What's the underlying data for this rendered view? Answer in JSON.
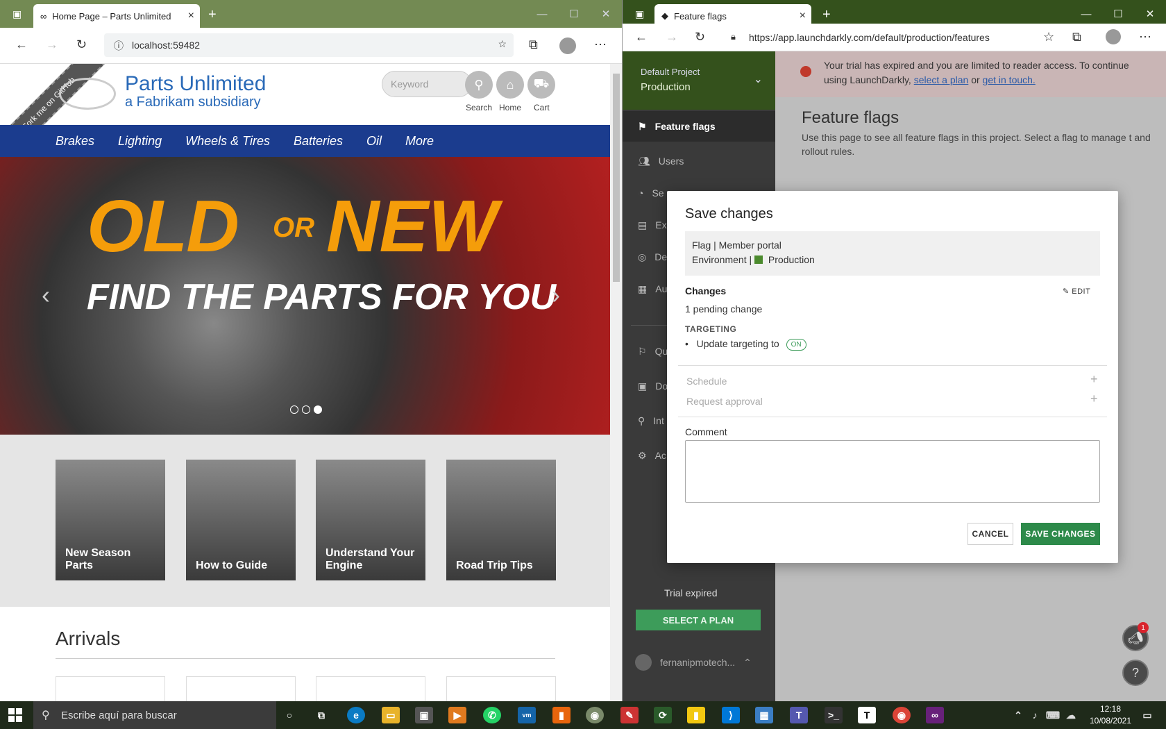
{
  "left_browser": {
    "tab_title": "Home Page – Parts Unlimited",
    "url": "localhost:59482",
    "site": {
      "logo_title": "Parts Unlimited",
      "logo_subtitle": "a Fabrikam subsidiary",
      "ribbon": "Fork me on GitHub",
      "search_placeholder": "Keyword",
      "search_label": "Search",
      "home_label": "Home",
      "cart_label": "Cart",
      "nav": [
        "Brakes",
        "Lighting",
        "Wheels & Tires",
        "Batteries",
        "Oil",
        "More"
      ],
      "hero": {
        "old": "OLD",
        "or": "OR",
        "new": "NEW",
        "subtitle": "FIND THE PARTS FOR YOU",
        "active_slide": 3,
        "slide_count": 3
      },
      "tiles": [
        "New Season Parts",
        "How to Guide",
        "Understand Your Engine",
        "Road Trip Tips"
      ],
      "arrivals_heading": "Arrivals"
    }
  },
  "right_browser": {
    "tab_title": "Feature flags",
    "url": "https://app.launchdarkly.com/default/production/features",
    "sidebar": {
      "project": "Default Project",
      "environment": "Production",
      "items": [
        {
          "label": "Feature flags",
          "icon": "flag-icon",
          "active": true
        },
        {
          "label": "Users",
          "icon": "users-icon"
        },
        {
          "label": "Se",
          "icon": "segments-icon"
        },
        {
          "label": "Ex",
          "icon": "experiments-icon"
        },
        {
          "label": "De",
          "icon": "debugger-icon"
        },
        {
          "label": "Au",
          "icon": "audit-icon"
        },
        {
          "label": "Qu",
          "icon": "quickstart-icon"
        },
        {
          "label": "Do",
          "icon": "docs-icon"
        },
        {
          "label": "Int",
          "icon": "integrations-icon"
        },
        {
          "label": "Ac",
          "icon": "account-icon"
        }
      ],
      "trial_expired": "Trial expired",
      "select_plan": "SELECT A PLAN",
      "user": "fernanipmotech..."
    },
    "banner": {
      "text": "Your trial has expired and you are limited to reader access. To continue using LaunchDarkly,",
      "link1": "select a plan",
      "or": "or",
      "link2": "get in touch."
    },
    "page_title": "Feature flags",
    "page_desc": "Use this page to see all feature flags in this project. Select a flag to manage t and rollout rules.",
    "notification_count": "1",
    "modal": {
      "title": "Save changes",
      "flag_line": "Flag | Member portal",
      "env_prefix": "Environment |",
      "env_name": "Production",
      "env_color": "#4b8a2d",
      "changes_heading": "Changes",
      "edit": "EDIT",
      "pending": "1 pending change",
      "targeting": "TARGETING",
      "update_text": "Update targeting to",
      "on_pill": "ON",
      "schedule": "Schedule",
      "request_approval": "Request approval",
      "comment_label": "Comment",
      "comment_value": "",
      "cancel": "CANCEL",
      "save": "SAVE CHANGES"
    }
  },
  "taskbar": {
    "search_placeholder": "Escribe aquí para buscar",
    "time": "12:18",
    "date": "10/08/2021"
  }
}
